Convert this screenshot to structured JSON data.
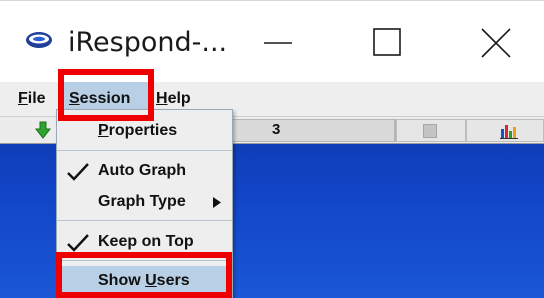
{
  "window": {
    "title": "iRespond-...",
    "icon": "irespond-app-icon",
    "controls": {
      "minimize_icon": "minimize-icon",
      "maximize_icon": "maximize-icon",
      "close_icon": "close-icon"
    }
  },
  "menubar": {
    "file_prefix": "",
    "file_mnemonic": "F",
    "file_rest": "ile",
    "session_mnemonic": "S",
    "session_rest": "ession",
    "help_mnemonic": "H",
    "help_rest": "elp"
  },
  "toolbar": {
    "count": "3",
    "icons": [
      "green-down-arrow-icon",
      "stop-square-icon",
      "bar-chart-icon"
    ]
  },
  "session_menu": {
    "properties_mnemonic": "P",
    "properties_rest": "roperties",
    "auto_graph": "Auto Graph",
    "auto_graph_checked": true,
    "graph_type": "Graph Type",
    "keep_on_top": "Keep on Top",
    "keep_on_top_checked": true,
    "show_users_prefix": "Show ",
    "show_users_mnemonic": "U",
    "show_users_rest": "sers"
  },
  "colors": {
    "highlight_red": "#ee0000",
    "menu_selected": "#b8cfe5",
    "desktop_blue": "#1247c9"
  }
}
